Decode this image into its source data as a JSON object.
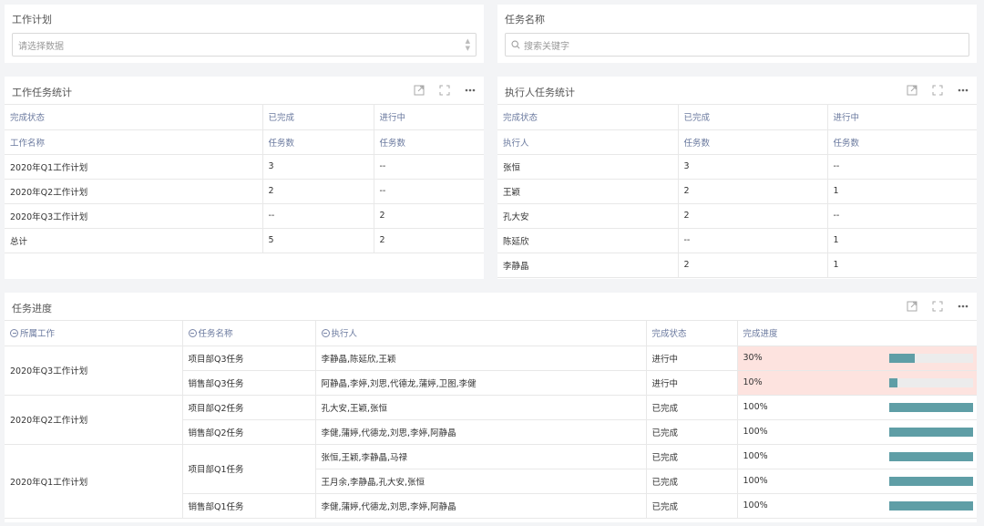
{
  "filters": {
    "work_plan": {
      "label": "工作计划",
      "placeholder": "请选择数据"
    },
    "task_name": {
      "label": "任务名称",
      "placeholder": "搜索关键字"
    }
  },
  "work_stats": {
    "title": "工作任务统计",
    "header1": [
      "完成状态",
      "已完成",
      "进行中"
    ],
    "header2": [
      "工作名称",
      "任务数",
      "任务数"
    ],
    "rows": [
      [
        "2020年Q1工作计划",
        "3",
        "--"
      ],
      [
        "2020年Q2工作计划",
        "2",
        "--"
      ],
      [
        "2020年Q3工作计划",
        "--",
        "2"
      ],
      [
        "总计",
        "5",
        "2"
      ]
    ]
  },
  "assignee_stats": {
    "title": "执行人任务统计",
    "header1": [
      "完成状态",
      "已完成",
      "进行中"
    ],
    "header2": [
      "执行人",
      "任务数",
      "任务数"
    ],
    "rows": [
      [
        "张恒",
        "3",
        "--"
      ],
      [
        "王颖",
        "2",
        "1"
      ],
      [
        "孔大安",
        "2",
        "--"
      ],
      [
        "陈延欣",
        "--",
        "1"
      ],
      [
        "李静晶",
        "2",
        "1"
      ]
    ]
  },
  "progress": {
    "title": "任务进度",
    "headers": [
      "所属工作",
      "任务名称",
      "执行人",
      "完成状态",
      "完成进度"
    ],
    "groups": [
      "2020年Q3工作计划",
      "2020年Q2工作计划",
      "2020年Q1工作计划"
    ],
    "rows": [
      {
        "task": "项目部Q3任务",
        "people": "李静晶,陈延欣,王颖",
        "status": "进行中",
        "pct": "30%",
        "value": 30
      },
      {
        "task": "销售部Q3任务",
        "people": "阿静晶,李婷,刘思,代德龙,蒲婷,卫图,李健",
        "status": "进行中",
        "pct": "10%",
        "value": 10
      },
      {
        "task": "项目部Q2任务",
        "people": "孔大安,王颖,张恒",
        "status": "已完成",
        "pct": "100%",
        "value": 100
      },
      {
        "task": "销售部Q2任务",
        "people": "李健,蒲婷,代德龙,刘思,李婷,阿静晶",
        "status": "已完成",
        "pct": "100%",
        "value": 100
      },
      {
        "task": "项目部Q1任务",
        "people": "张恒,王颖,李静晶,马禄",
        "status": "已完成",
        "pct": "100%",
        "value": 100
      },
      {
        "task": "",
        "people": "王月余,李静晶,孔大安,张恒",
        "status": "已完成",
        "pct": "100%",
        "value": 100
      },
      {
        "task": "销售部Q1任务",
        "people": "李健,蒲婷,代德龙,刘思,李婷,阿静晶",
        "status": "已完成",
        "pct": "100%",
        "value": 100
      }
    ]
  },
  "colors": {
    "bar": "#5f9ea6",
    "highlight": "#fde3df",
    "header_text": "#6b7a9f"
  },
  "icons": [
    "export-icon",
    "fullscreen-icon",
    "more-icon",
    "search-icon"
  ]
}
